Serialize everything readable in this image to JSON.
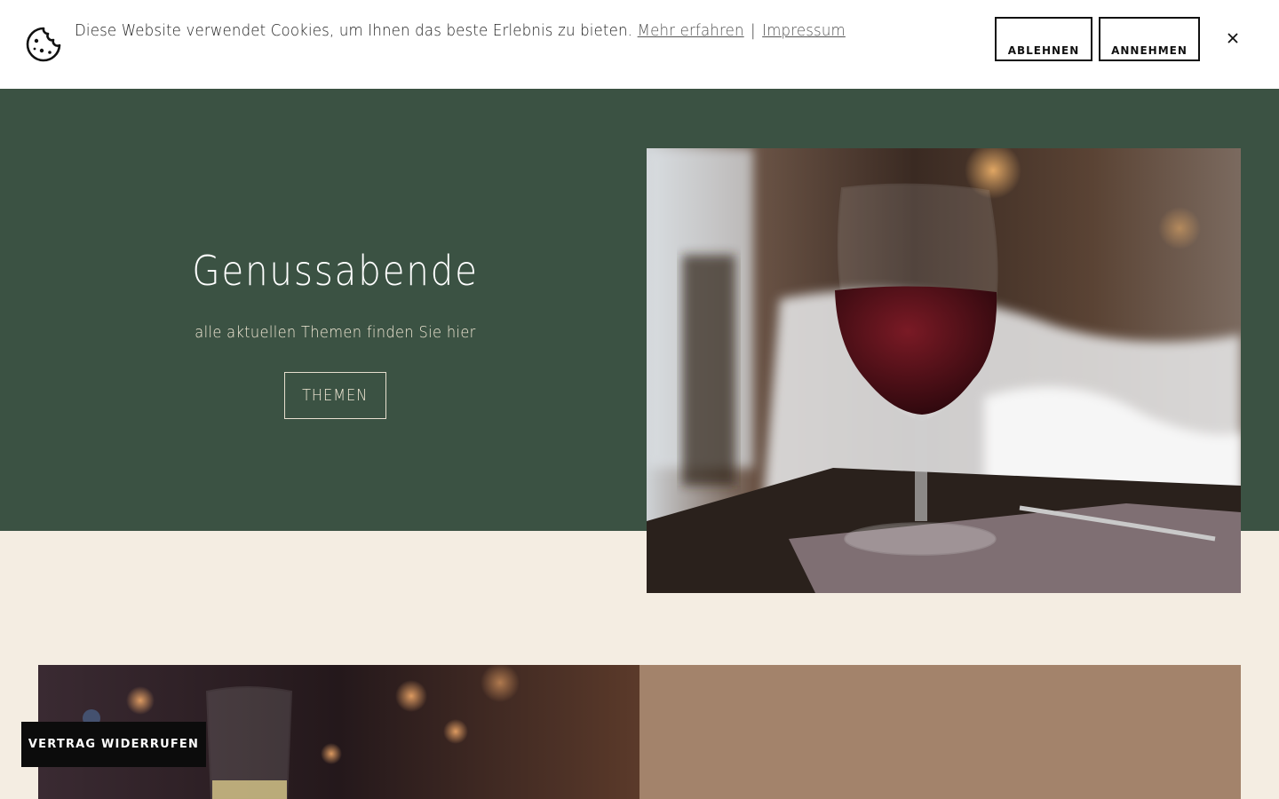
{
  "cookie_banner": {
    "message": "Diese Website verwendet Cookies, um Ihnen das beste Erlebnis zu bieten.",
    "learn_more": "Mehr erfahren",
    "separator": "|",
    "imprint": "Impressum",
    "decline_label": "ABLEHNEN",
    "accept_label": "ANNEHMEN",
    "icons": {
      "cookie": "cookie-icon",
      "close": "close-icon"
    }
  },
  "hero": {
    "title": "Genussabende",
    "subtitle": "alle aktuellen Themen finden Sie hier",
    "button_label": "THEMEN"
  },
  "floating": {
    "revoke_label": "VERTRAG WIDERRUFEN"
  },
  "colors": {
    "hero_green": "#3b5243",
    "cream": "#f4ede2",
    "taupe": "#a3836b"
  }
}
